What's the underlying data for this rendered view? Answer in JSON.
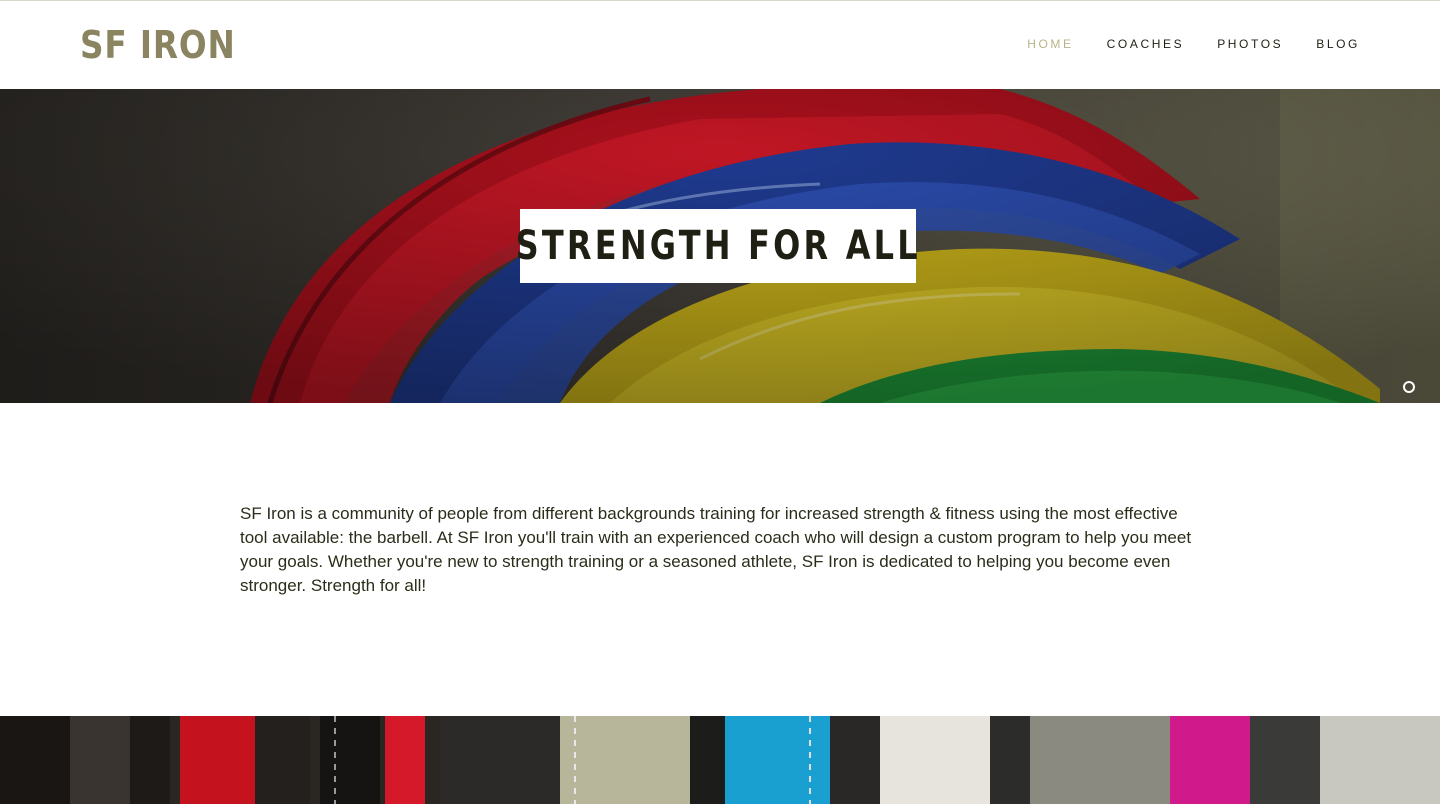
{
  "header": {
    "logo": "SF IRON",
    "nav": [
      {
        "label": "HOME",
        "active": true
      },
      {
        "label": "COACHES",
        "active": false
      },
      {
        "label": "PHOTOS",
        "active": false
      },
      {
        "label": "BLOG",
        "active": false
      }
    ]
  },
  "hero": {
    "title": "STRENGTH FOR ALL",
    "image": "colorful-bumper-plates-photo",
    "slide_indicator_icon": "slide-dot-icon"
  },
  "intro": {
    "text": "SF Iron is a community of people from different backgrounds training for increased strength & fitness using the most effective tool available: the barbell. At SF Iron you'll train with an experienced coach who will design a custom program to help you meet your goals. Whether you're new to strength training or a seasoned athlete, SF Iron is dedicated to helping you become even stronger. Strength for all!"
  },
  "bottom_banner": {
    "image": "lifting-belts-photo"
  },
  "colors": {
    "logo": "#8a8560",
    "nav_active": "#b9b488",
    "text": "#2c2c1a"
  }
}
